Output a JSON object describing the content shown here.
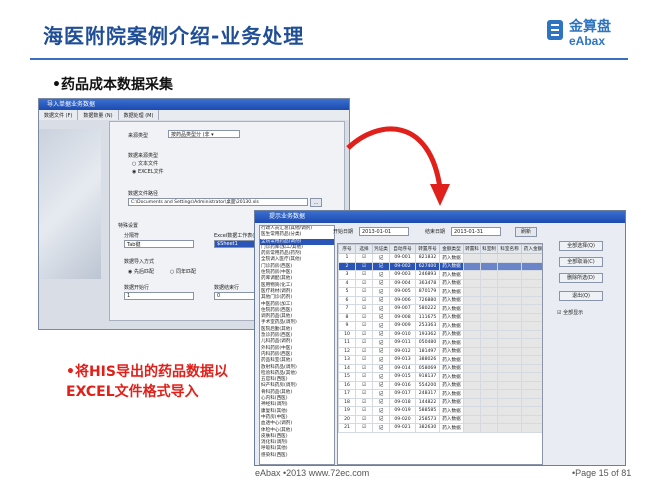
{
  "slide": {
    "title": "海医附院案例介绍-业务处理",
    "bullet": "•药品成本数据采集",
    "note": "•将HIS导出的药品数据以EXCEL文件格式导入",
    "footer": "eAbax •2013 www.72ec.com",
    "page": "•Page 15 of 81"
  },
  "logo": {
    "cn": "金算盘",
    "en": "eAbax",
    "color": "#2f74c0"
  },
  "colors": {
    "title": "#1f4e96",
    "note": "#e0201a",
    "arrow": "#e0201a",
    "rule": "#3b6fc2"
  },
  "window1": {
    "title": "导入单据业务数据",
    "tabs": [
      "数据文件 (F)",
      "数据数量 (N)",
      "数据处理 (M)"
    ],
    "type_label": "来源类型",
    "type_value": "按药品类型分 (非 ▾",
    "format_label": "数据来源类型",
    "radio_text": "文本文件",
    "radio_excel": "EXCEL文件",
    "path_label": "数据文件路径",
    "path_value": "C:\\Documents and Settings\\Administrator\\桌面\\20130.xls",
    "settings_label": "特殊设置",
    "sep_label": "分隔符",
    "sep_value": "Tab键",
    "sheet_label": "Excel数据工作表(S)",
    "sheet_value": "$Sheet1",
    "mode_label": "数据导入方式",
    "mode_a": "先后匹配",
    "mode_b": "同年匹配",
    "start_label": "数据开始行",
    "start_value": "1",
    "end_label": "数据结束行",
    "end_value": "0",
    "btn_back": "退出",
    "btn_next": "导入"
  },
  "window2": {
    "title": "提示业务数据",
    "start_label": "开始日期",
    "start_value": "2013-01-01",
    "end_label": "结束日期",
    "end_value": "2013-01-31",
    "refresh": "刷新",
    "tree": [
      "行政人员汇总(其他/调剂)",
      "医生常用药品(分类)",
      "全院常用药品(调剂)",
      "门诊药库(加工/其他)",
      "药房常用药品(药剂)",
      "全院调入医疗(其他)",
      "门诊药房(西医)",
      "住院药房(中医)",
      "药库调配(其他)",
      "医用物资(化工)",
      "医疗耗材(调剂)",
      "其他门诊(药剂)",
      "中医药房(加工)",
      "住院药房(西医)",
      "调剂药品(其他)",
      "手术室药品(调剂)",
      "医院后勤(其他)",
      "急诊药房(西医)",
      "儿科药品(调剂)",
      "外科药房(中医)",
      "内科药房(西医)",
      "药品科室(其他)",
      "放射科药品(调剂)",
      "检验科药品(其他)",
      "五官科(西医)",
      "妇产科药房(调剂)",
      "骨科药品(其他)",
      "心内科(西医)",
      "神经科(调剂)",
      "康复科(其他)",
      "中药房(中医)",
      "血透中心(调剂)",
      "体检中心(其他)",
      "皮肤科(西医)",
      "消化科(调剂)",
      "呼吸科(其他)",
      "感染科(西医)"
    ],
    "columns": [
      "序号",
      "选择",
      "凭证类",
      "自动序号",
      "转置序号",
      "金额类型",
      "转置科",
      "科室制",
      "科室名称",
      "药入金额"
    ],
    "rows": [
      {
        "no": "1",
        "sel": "☑",
        "vt": "记",
        "seq": "09-001",
        "tr": "821832",
        "amt": "药入数据"
      },
      {
        "no": "2",
        "sel": "☑",
        "vt": "记",
        "seq": "09-002",
        "tr": "627400",
        "amt": "药入数据"
      },
      {
        "no": "3",
        "sel": "☑",
        "vt": "记",
        "seq": "09-003",
        "tr": "246893",
        "amt": "药入数据"
      },
      {
        "no": "4",
        "sel": "☑",
        "vt": "记",
        "seq": "09-004",
        "tr": "363478",
        "amt": "药入数据"
      },
      {
        "no": "5",
        "sel": "☑",
        "vt": "记",
        "seq": "09-005",
        "tr": "870179",
        "amt": "药入数据"
      },
      {
        "no": "6",
        "sel": "☑",
        "vt": "记",
        "seq": "09-006",
        "tr": "726880",
        "amt": "药入数据"
      },
      {
        "no": "7",
        "sel": "☑",
        "vt": "记",
        "seq": "09-007",
        "tr": "580222",
        "amt": "药入数据"
      },
      {
        "no": "8",
        "sel": "☑",
        "vt": "记",
        "seq": "09-008",
        "tr": "111675",
        "amt": "药入数据"
      },
      {
        "no": "9",
        "sel": "☑",
        "vt": "记",
        "seq": "09-009",
        "tr": "253363",
        "amt": "药入数据"
      },
      {
        "no": "10",
        "sel": "☑",
        "vt": "记",
        "seq": "09-010",
        "tr": "193362",
        "amt": "药入数据"
      },
      {
        "no": "11",
        "sel": "☑",
        "vt": "记",
        "seq": "09-011",
        "tr": "050480",
        "amt": "药入数据"
      },
      {
        "no": "12",
        "sel": "☑",
        "vt": "记",
        "seq": "09-012",
        "tr": "181497",
        "amt": "药入数据"
      },
      {
        "no": "13",
        "sel": "☑",
        "vt": "记",
        "seq": "09-013",
        "tr": "388026",
        "amt": "药入数据"
      },
      {
        "no": "14",
        "sel": "☑",
        "vt": "记",
        "seq": "09-014",
        "tr": "058069",
        "amt": "药入数据"
      },
      {
        "no": "15",
        "sel": "☑",
        "vt": "记",
        "seq": "09-015",
        "tr": "918137",
        "amt": "药入数据"
      },
      {
        "no": "16",
        "sel": "☑",
        "vt": "记",
        "seq": "09-016",
        "tr": "554200",
        "amt": "药入数据"
      },
      {
        "no": "17",
        "sel": "☑",
        "vt": "记",
        "seq": "09-017",
        "tr": "248317",
        "amt": "药入数据"
      },
      {
        "no": "18",
        "sel": "☑",
        "vt": "记",
        "seq": "09-018",
        "tr": "144822",
        "amt": "药入数据"
      },
      {
        "no": "19",
        "sel": "☑",
        "vt": "记",
        "seq": "09-019",
        "tr": "588585",
        "amt": "药入数据"
      },
      {
        "no": "20",
        "sel": "☑",
        "vt": "记",
        "seq": "09-020",
        "tr": "258573",
        "amt": "药入数据"
      },
      {
        "no": "21",
        "sel": "☑",
        "vt": "记",
        "seq": "09-021",
        "tr": "382630",
        "amt": "药入数据"
      }
    ],
    "side_buttons": [
      "全部选择(Q)",
      "全部取消(C)",
      "删除所选(D)",
      "退出(Q)"
    ],
    "show_all": "全部显示"
  }
}
